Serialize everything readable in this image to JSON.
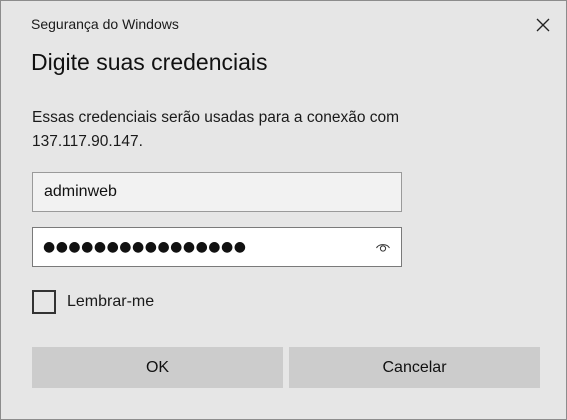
{
  "window": {
    "title": "Segurança do Windows",
    "close_icon": "close-icon"
  },
  "dialog": {
    "heading": "Digite suas credenciais",
    "description_line1": "Essas credenciais serão usadas para a conexão com",
    "description_line2": "137.117.90.147."
  },
  "username": {
    "value": "adminweb"
  },
  "password": {
    "masked_value": "●●●●●●●●●●●●●●●●",
    "reveal_icon": "eye-icon"
  },
  "remember": {
    "label": "Lembrar-me",
    "checked": false
  },
  "buttons": {
    "ok_label": "OK",
    "cancel_label": "Cancelar"
  }
}
